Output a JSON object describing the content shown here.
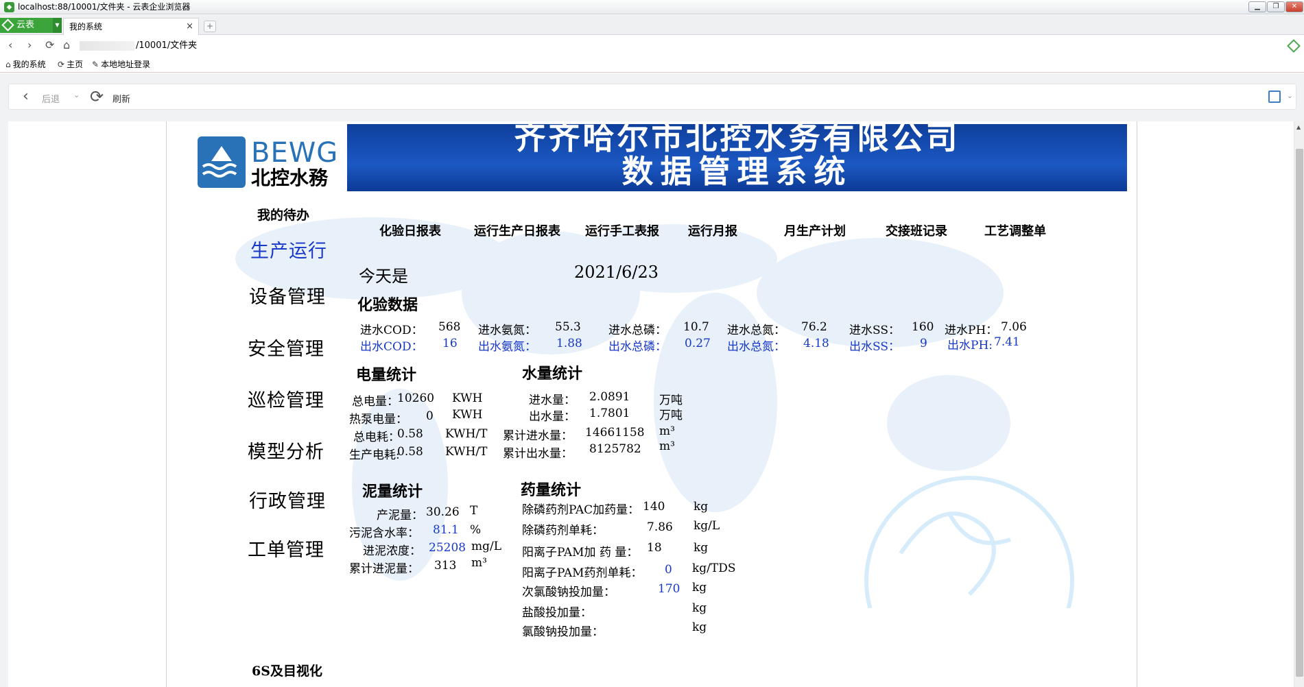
{
  "browser": {
    "window_title": "localhost:88/10001/文件夹 - 云表企业浏览器",
    "brand": "云表",
    "tab_title": "我的系统",
    "tab_close": "×",
    "new_tab": "+",
    "url_suffix": "/10001/文件夹",
    "bookmarks": [
      "我的系统",
      "主页",
      "本地地址登录"
    ],
    "toolbar": {
      "back": "后退",
      "refresh": "刷新"
    }
  },
  "header": {
    "logo_en": "BEWG",
    "logo_cn": "北控水務",
    "banner_line1": "齐齐哈尔市北控水务有限公司",
    "banner_line2": "数据管理系统"
  },
  "sidebar": {
    "todo": "我的待办",
    "items": [
      "生产运行",
      "设备管理",
      "安全管理",
      "巡检管理",
      "模型分析",
      "行政管理",
      "工单管理"
    ],
    "footer": "6S及目视化"
  },
  "top_nav": [
    "化验日报表",
    "运行生产日报表",
    "运行手工表报",
    "运行月报",
    "月生产计划",
    "交接班记录",
    "工艺调整单"
  ],
  "today": {
    "label": "今天是",
    "date": "2021/6/23"
  },
  "lab": {
    "title": "化验数据",
    "inflow": [
      {
        "label": "进水COD：",
        "value": "568"
      },
      {
        "label": "进水氨氮：",
        "value": "55.3"
      },
      {
        "label": "进水总磷：",
        "value": "10.7"
      },
      {
        "label": "进水总氮：",
        "value": "76.2"
      },
      {
        "label": "进水SS：",
        "value": "160"
      },
      {
        "label": "进水PH：",
        "value": "7.06"
      }
    ],
    "outflow": [
      {
        "label": "出水COD：",
        "value": "16"
      },
      {
        "label": "出水氨氮：",
        "value": "1.88"
      },
      {
        "label": "出水总磷：",
        "value": "0.27"
      },
      {
        "label": "出水总氮：",
        "value": "4.18"
      },
      {
        "label": "出水SS：",
        "value": "9"
      },
      {
        "label": "出水PH:",
        "value": "7.41"
      }
    ]
  },
  "power": {
    "title": "电量统计",
    "rows": [
      {
        "label": "总电量：",
        "value": "10260",
        "unit": "KWH"
      },
      {
        "label": "热泵电量：",
        "value": "0",
        "unit": "KWH"
      },
      {
        "label": "总电耗：",
        "value": "0.58",
        "unit": "KWH/T"
      },
      {
        "label": "生产电耗:",
        "value": "0.58",
        "unit": "KWH/T"
      }
    ]
  },
  "water": {
    "title": "水量统计",
    "rows": [
      {
        "label": "进水量：",
        "value": "2.0891",
        "unit": "万吨"
      },
      {
        "label": "出水量：",
        "value": "1.7801",
        "unit": "万吨"
      },
      {
        "label": "累计进水量：",
        "value": "14661158",
        "unit": "m³"
      },
      {
        "label": "累计出水量：",
        "value": "8125782",
        "unit": "m³"
      }
    ]
  },
  "sludge": {
    "title": "泥量统计",
    "rows": [
      {
        "label": "产泥量：",
        "value": "30.26",
        "unit": "T"
      },
      {
        "label": "污泥含水率：",
        "value": "81.1",
        "unit": "%"
      },
      {
        "label": "进泥浓度：",
        "value": "25208",
        "unit": "mg/L"
      },
      {
        "label": "累计进泥量：",
        "value": "313",
        "unit": "m³"
      }
    ]
  },
  "chem": {
    "title": "药量统计",
    "rows": [
      {
        "label": "除磷药剂PAC加药量：",
        "value": "140",
        "unit": "kg"
      },
      {
        "label": "除磷药剂单耗：",
        "value": "7.86",
        "unit": "kg/L"
      },
      {
        "label": "阳离子PAM加 药 量：",
        "value": "18",
        "unit": "kg"
      },
      {
        "label": "阳离子PAM药剂单耗：",
        "value": "0",
        "unit": "kg/TDS"
      },
      {
        "label": "次氯酸钠投加量：",
        "value": "170",
        "unit": "kg"
      },
      {
        "label": "盐酸投加量：",
        "value": "",
        "unit": "kg"
      },
      {
        "label": "氯酸钠投加量：",
        "value": "",
        "unit": "kg"
      }
    ]
  }
}
